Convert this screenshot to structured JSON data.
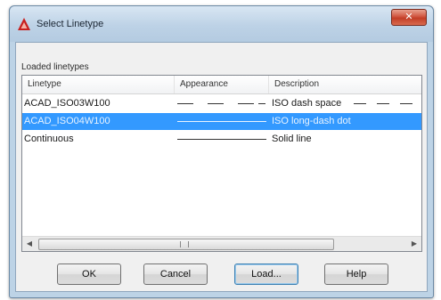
{
  "window": {
    "title": "Select Linetype"
  },
  "group_label": "Loaded linetypes",
  "list": {
    "columns": [
      "Linetype",
      "Appearance",
      "Description"
    ],
    "rows": [
      {
        "linetype": "ACAD_ISO03W100",
        "description": "ISO dash space",
        "pattern": "dash-space",
        "selected": false
      },
      {
        "linetype": "ACAD_ISO04W100",
        "description": "ISO long-dash dot",
        "pattern": "solid",
        "selected": true
      },
      {
        "linetype": "Continuous",
        "description": "Solid line",
        "pattern": "solid",
        "selected": false
      }
    ]
  },
  "buttons": {
    "ok": "OK",
    "cancel": "Cancel",
    "load": "Load...",
    "help": "Help"
  },
  "colors": {
    "selection": "#3399ff",
    "close_button": "#c23d26"
  }
}
